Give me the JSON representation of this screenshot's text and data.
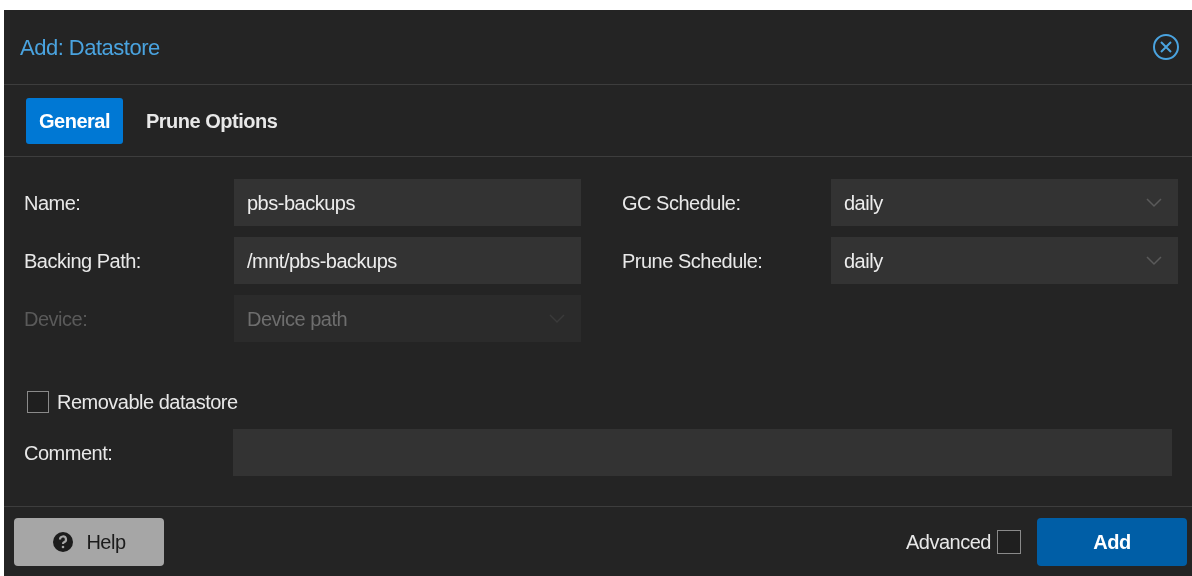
{
  "window": {
    "title": "Add: Datastore"
  },
  "tabs": [
    {
      "label": "General",
      "selected": true
    },
    {
      "label": "Prune Options",
      "selected": false
    }
  ],
  "left_fields": [
    {
      "label": "Name:",
      "kind": "text",
      "value": "pbs-backups",
      "disabled": false
    },
    {
      "label": "Backing Path:",
      "kind": "text",
      "value": "/mnt/pbs-backups",
      "disabled": false
    },
    {
      "label": "Device:",
      "kind": "combo",
      "placeholder": "Device path",
      "disabled": true
    }
  ],
  "right_fields": [
    {
      "label": "GC Schedule:",
      "kind": "combo",
      "value": "daily",
      "disabled": false
    },
    {
      "label": "Prune Schedule:",
      "kind": "combo",
      "value": "daily",
      "disabled": false
    }
  ],
  "removable": {
    "label": "Removable datastore",
    "checked": false
  },
  "comment": {
    "label": "Comment:"
  },
  "footer": {
    "help": "Help",
    "advanced": {
      "label": "Advanced",
      "checked": false
    },
    "submit": "Add"
  }
}
